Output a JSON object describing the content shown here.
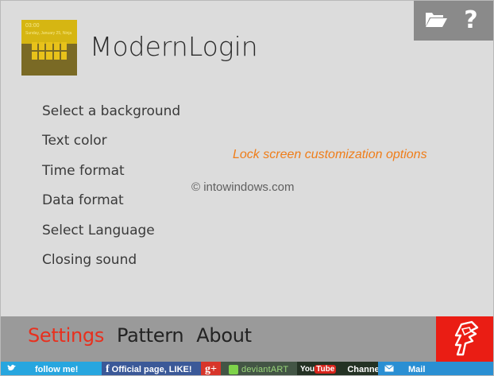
{
  "window": {
    "toolbar": {
      "open_icon": "folder-open-icon",
      "help_icon": "help-icon",
      "help_glyph": "?"
    },
    "app": {
      "title": "ModernLogin",
      "tile_time": "03:00",
      "tile_date": "Sunday, January 25, Ninja"
    },
    "menu": {
      "items": [
        "Select a background",
        "Text color",
        "Time format",
        "Data format",
        "Select Language",
        "Closing sound"
      ]
    },
    "caption": "Lock screen customization options",
    "watermark": "© intowindows.com",
    "nav": {
      "tabs": [
        "Settings",
        "Pattern",
        "About"
      ],
      "active": "Settings"
    },
    "social": {
      "twitter": "follow me!",
      "facebook_glyph": "f",
      "facebook": "Official page, LIKE!",
      "gplus": "g+",
      "deviantart": "deviantART",
      "youtube_you": "You",
      "youtube_tube": "Tube",
      "youtube": "Channel",
      "mail": "Mail"
    }
  },
  "colors": {
    "accent": "#e8301e",
    "caption": "#ef7d19",
    "logo_bg": "#ea1d14",
    "toolbar_bg": "#8a8a8a",
    "bottom_bar": "#9a9a9a"
  }
}
